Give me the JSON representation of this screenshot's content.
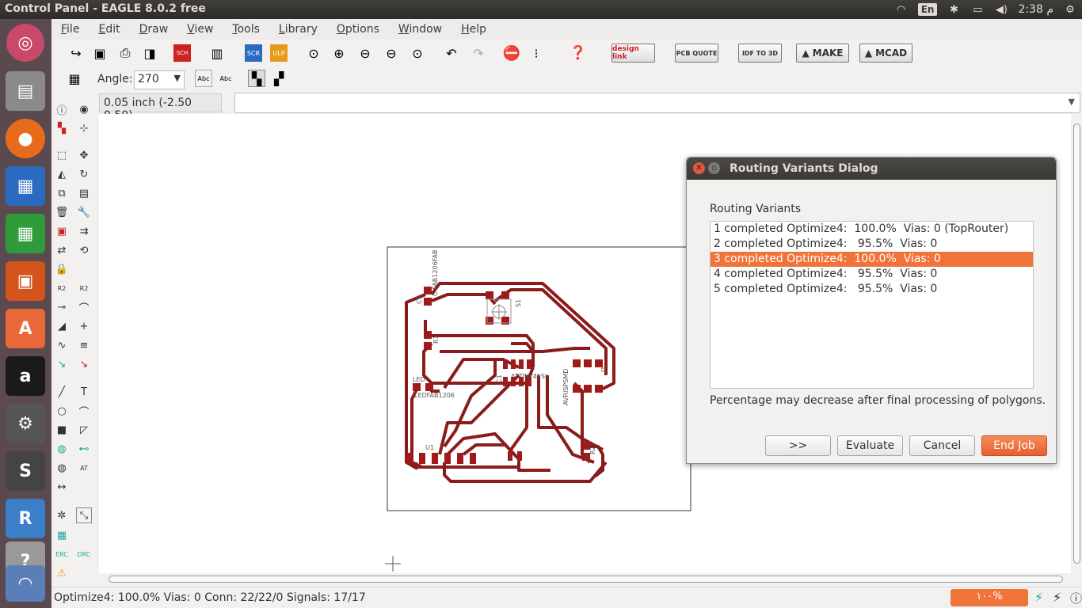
{
  "window_title": "Control Panel - EAGLE 8.0.2 free",
  "tray": {
    "lang": "En",
    "clock": "2:38 م"
  },
  "menu": [
    "File",
    "Edit",
    "Draw",
    "View",
    "Tools",
    "Library",
    "Options",
    "Window",
    "Help"
  ],
  "toolbar": {
    "design_link": "design link",
    "pcb_quote": "PCB QUOTE",
    "idf": "IDF TO 3D",
    "make": "MAKE",
    "mcad": "MCAD"
  },
  "angle": {
    "label": "Angle:",
    "value": "270"
  },
  "coordinates": "0.05 inch (-2.50 0.50)",
  "board_labels": {
    "c1": "C1",
    "c1_pkg": "C-FAB1206FAB",
    "s1": "S1",
    "r": "R1",
    "led": "LED",
    "led_pkg": "LEDFAB1206",
    "ic": "ATTINY45SI",
    "avrisp": "AVRISPSMD",
    "u": "U1",
    "j": "J1",
    "r2": "R2",
    "c2": "C1"
  },
  "dialog": {
    "title": "Routing Variants Dialog",
    "label": "Routing Variants",
    "variants": [
      "1 completed Optimize4:  100.0%  Vias: 0 (TopRouter)",
      "2 completed Optimize4:   95.5%  Vias: 0",
      "3 completed Optimize4:  100.0%  Vias: 0",
      "4 completed Optimize4:   95.5%  Vias: 0",
      "5 completed Optimize4:   95.5%  Vias: 0"
    ],
    "selected_index": 2,
    "note": "Percentage may decrease after final processing of polygons.",
    "buttons": {
      "next": ">>",
      "evaluate": "Evaluate",
      "cancel": "Cancel",
      "end_job": "End Job"
    }
  },
  "status": {
    "text": "Optimize4: 100.0%  Vias: 0  Conn: 22/22/0  Signals: 17/17",
    "progress": "١٠٠%"
  },
  "colors": {
    "accent": "#f0733a",
    "trace": "#8b1c1c"
  }
}
